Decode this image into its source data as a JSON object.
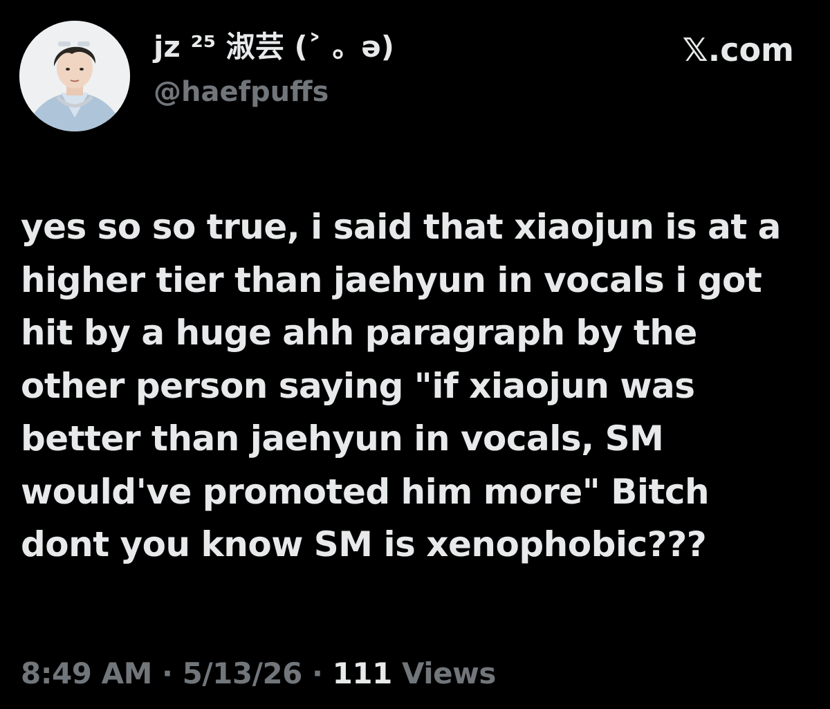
{
  "tweet": {
    "author": {
      "display_name": "jz ²⁵ 淑芸 (˃ 。ə)",
      "handle": "@haefpuffs"
    },
    "source": "𝕏.com",
    "text": "yes so so true, i said that xiaojun is at a higher tier than jaehyun in vocals i got hit by a huge ahh paragraph by the other person saying \"if xiaojun was better than jaehyun in vocals, SM would've promoted him more\" Bitch dont you know SM is xenophobic???",
    "time": "8:49 AM",
    "separator": "·",
    "date": "5/13/26",
    "views_count": "111",
    "views_label": "Views"
  },
  "icons": {
    "avatar": "profile-avatar-photo"
  },
  "colors": {
    "background": "#000000",
    "primary_text": "#e7e9ea",
    "secondary_text": "#71767b"
  }
}
